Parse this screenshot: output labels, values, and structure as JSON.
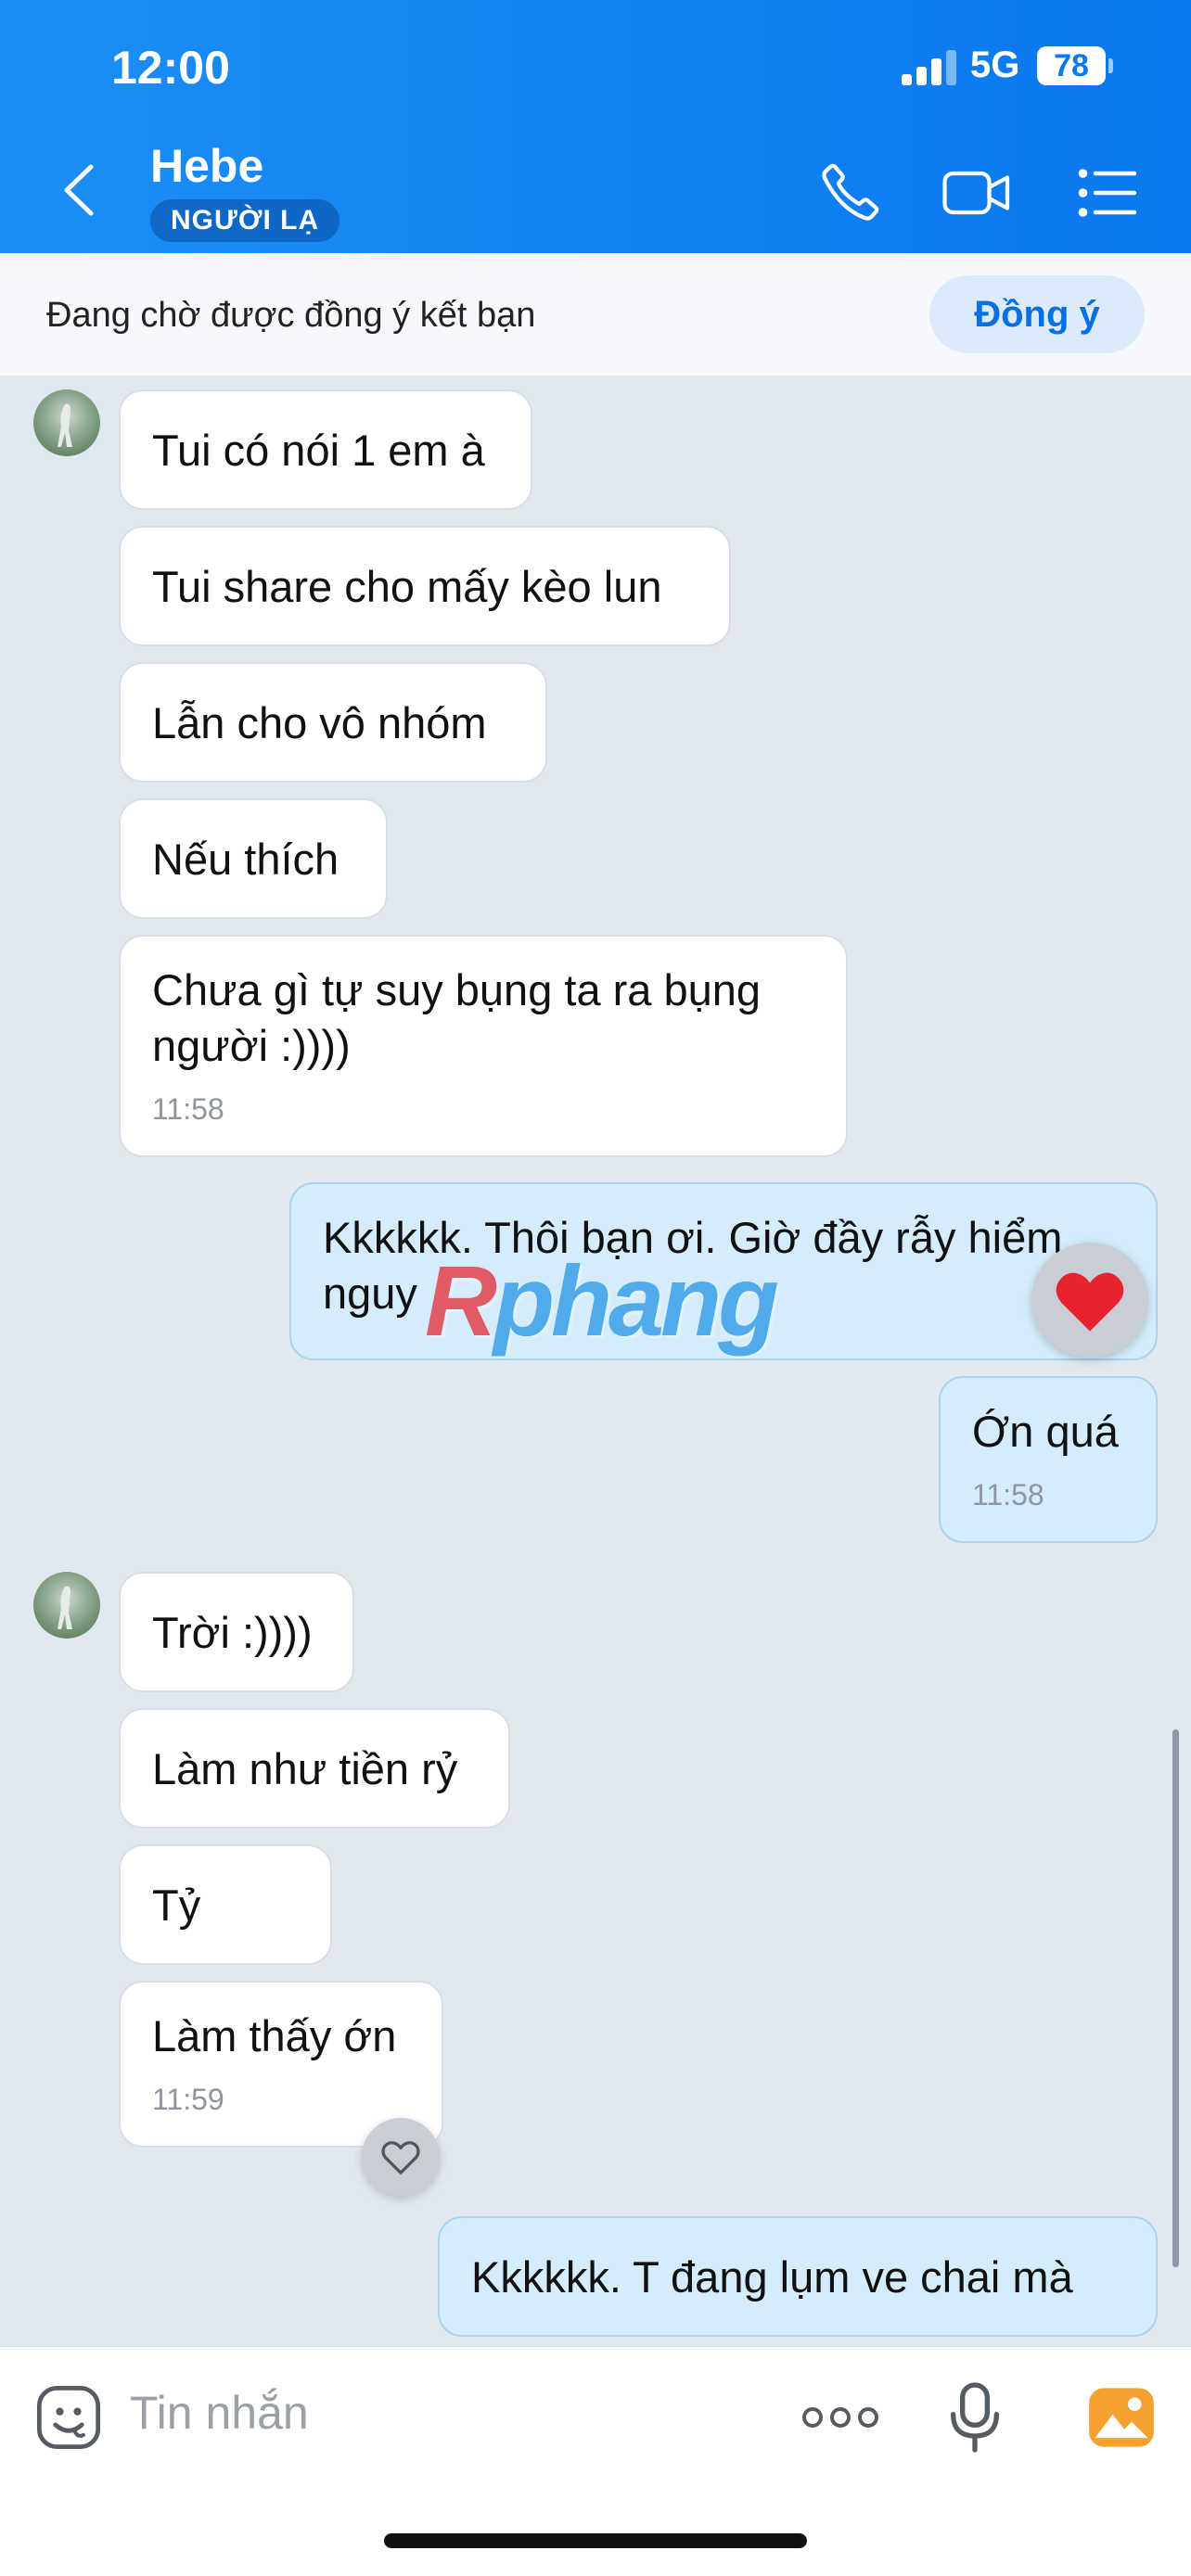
{
  "status_bar": {
    "time": "12:00",
    "network": "5G",
    "battery": "78"
  },
  "header": {
    "contact_name": "Hebe",
    "badge": "NGƯỜI LẠ"
  },
  "banner": {
    "text": "Đang chờ được đồng ý kết bạn",
    "accept_label": "Đồng ý"
  },
  "messages": [
    {
      "side": "in",
      "text": "Tui có nói 1 em à"
    },
    {
      "side": "in",
      "text": "Tui share cho mấy kèo lun"
    },
    {
      "side": "in",
      "text": "Lẫn cho vô nhóm"
    },
    {
      "side": "in",
      "text": "Nếu thích"
    },
    {
      "side": "in",
      "text": "Chưa gì tự suy bụng ta ra bụng người :))))",
      "time": "11:58"
    },
    {
      "side": "out",
      "text": "Kkkkkk. Thôi bạn ơi. Giờ đầy rẫy hiểm nguy",
      "reaction": "heart"
    },
    {
      "side": "out",
      "text": "Ớn quá",
      "time": "11:58"
    },
    {
      "side": "in",
      "text": "Trời :))))"
    },
    {
      "side": "in",
      "text": "Làm như tiền rỷ"
    },
    {
      "side": "in",
      "text": "Tỷ"
    },
    {
      "side": "in",
      "text": "Làm thấy ớn",
      "time": "11:59",
      "reaction": "heart-outline"
    },
    {
      "side": "out",
      "text": "Kkkkkk. T đang lụm ve chai mà"
    }
  ],
  "watermark": {
    "first": "R",
    "rest": "phang"
  },
  "composer": {
    "placeholder": "Tin nhắn"
  },
  "icons": [
    "back-chevron-icon",
    "phone-icon",
    "video-call-icon",
    "menu-icon",
    "sticker-icon",
    "more-icon",
    "microphone-icon",
    "image-icon"
  ],
  "colors": {
    "header": "#0a78ee",
    "incoming_bubble": "#ffffff",
    "outgoing_bubble": "#d4ecfb",
    "chat_background": "#e2e8f0",
    "accent": "#0a6fe0"
  }
}
